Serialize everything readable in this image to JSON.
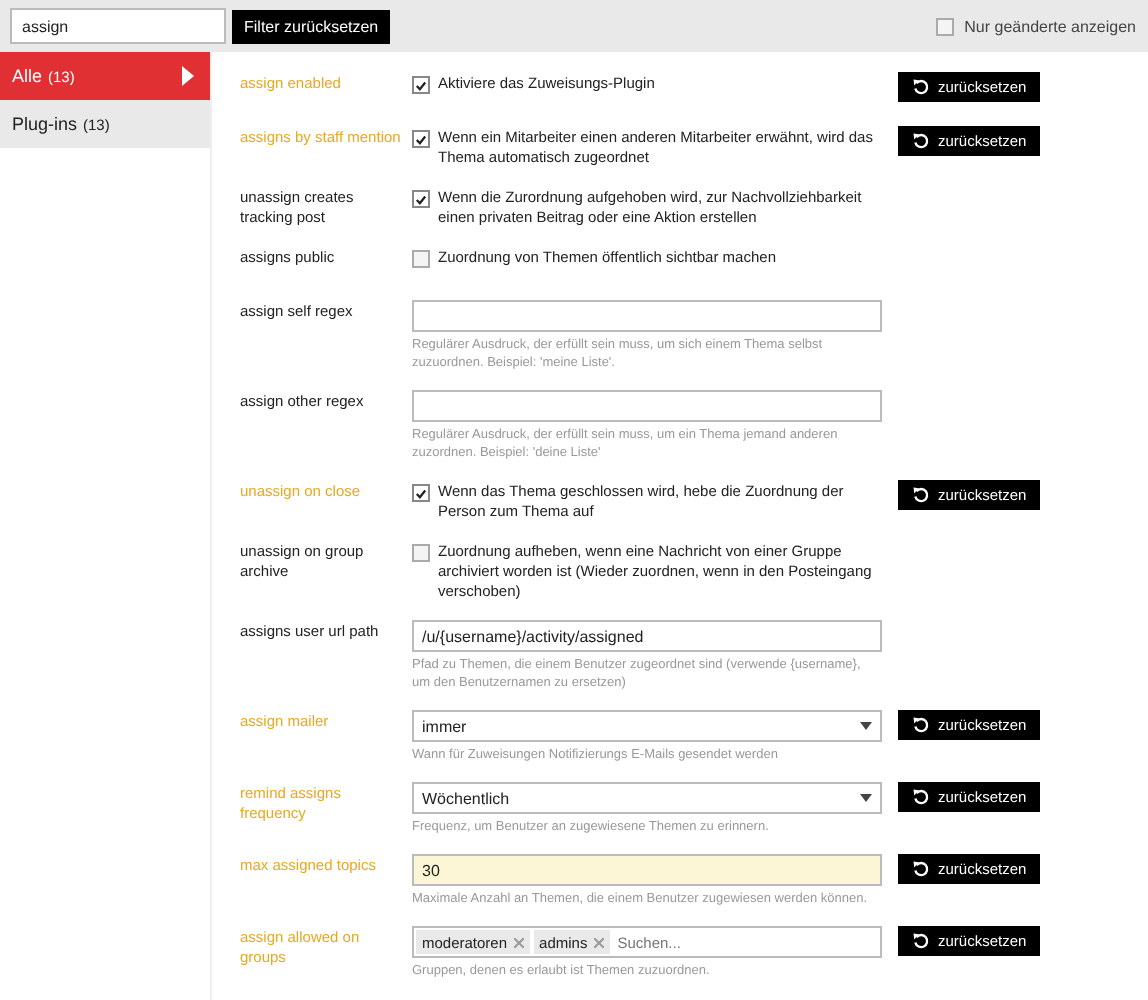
{
  "filter": {
    "value": "assign",
    "button": "Filter zurücksetzen",
    "only_changed": {
      "label": "Nur geänderte anzeigen",
      "checked": false
    }
  },
  "sidebar": {
    "items": [
      {
        "label": "Alle",
        "count": "(13)",
        "selected": true
      },
      {
        "label": "Plug-ins",
        "count": "(13)",
        "selected": false
      }
    ]
  },
  "settings": [
    {
      "label": "assign enabled",
      "changed": true,
      "kind": "checkbox",
      "checked": true,
      "text": "Aktiviere das Zuweisungs-Plugin",
      "reset": "zurücksetzen"
    },
    {
      "label": "assigns by staff mention",
      "changed": true,
      "kind": "checkbox",
      "checked": true,
      "text": "Wenn ein Mitarbeiter einen anderen Mitarbeiter erwähnt, wird das Thema automatisch zugeordnet",
      "reset": "zurücksetzen"
    },
    {
      "label": "unassign creates tracking post",
      "changed": false,
      "kind": "checkbox",
      "checked": true,
      "text": "Wenn die Zurordnung aufgehoben wird, zur Nachvollziehbarkeit einen privaten Beitrag oder eine Aktion erstellen"
    },
    {
      "label": "assigns public",
      "changed": false,
      "kind": "checkbox",
      "checked": false,
      "text": "Zuordnung von Themen öffentlich sichtbar machen"
    },
    {
      "label": "assign self regex",
      "changed": false,
      "kind": "text",
      "help": "Regulärer Ausdruck, der erfüllt sein muss, um sich einem Thema selbst zuzuordnen. Beispiel: 'meine Liste'."
    },
    {
      "label": "assign other regex",
      "changed": false,
      "kind": "text",
      "help": "Regulärer Ausdruck, der erfüllt sein muss, um ein Thema jemand anderen zuzordnen. Beispiel: 'deine Liste'"
    },
    {
      "label": "unassign on close",
      "changed": true,
      "kind": "checkbox",
      "checked": true,
      "text": "Wenn das Thema geschlossen wird, hebe die Zuordnung der Person zum Thema auf",
      "reset": "zurücksetzen"
    },
    {
      "label": "unassign on group archive",
      "changed": false,
      "kind": "checkbox",
      "checked": false,
      "text": "Zuordnung aufheben, wenn eine Nachricht von einer Gruppe archiviert worden ist (Wieder zuordnen, wenn in den Posteingang verschoben)"
    },
    {
      "label": "assigns user url path",
      "changed": false,
      "kind": "text",
      "value": "/u/{username}/activity/assigned",
      "help": "Pfad zu Themen, die einem Benutzer zugeordnet sind (verwende {username}, um den Benutzernamen zu ersetzen)"
    },
    {
      "label": "assign mailer",
      "changed": true,
      "kind": "select",
      "value": "immer",
      "help": "Wann für Zuweisungen Notifizierungs E-Mails gesendet werden",
      "reset": "zurücksetzen"
    },
    {
      "label": "remind assigns frequency",
      "changed": true,
      "kind": "select",
      "value": "Wöchentlich",
      "help": "Frequenz, um Benutzer an zugewiesene Themen zu erinnern.",
      "reset": "zurücksetzen"
    },
    {
      "label": "max assigned topics",
      "changed": true,
      "kind": "text",
      "highlighted": true,
      "value": "30",
      "help": "Maximale Anzahl an Themen, die einem Benutzer zugewiesen werden können.",
      "reset": "zurücksetzen"
    },
    {
      "label": "assign allowed on groups",
      "changed": true,
      "kind": "tags",
      "tags": [
        "moderatoren",
        "admins"
      ],
      "placeholder": "Suchen...",
      "help": "Gruppen, denen es erlaubt ist Themen zuzuordnen.",
      "reset": "zurücksetzen"
    }
  ]
}
